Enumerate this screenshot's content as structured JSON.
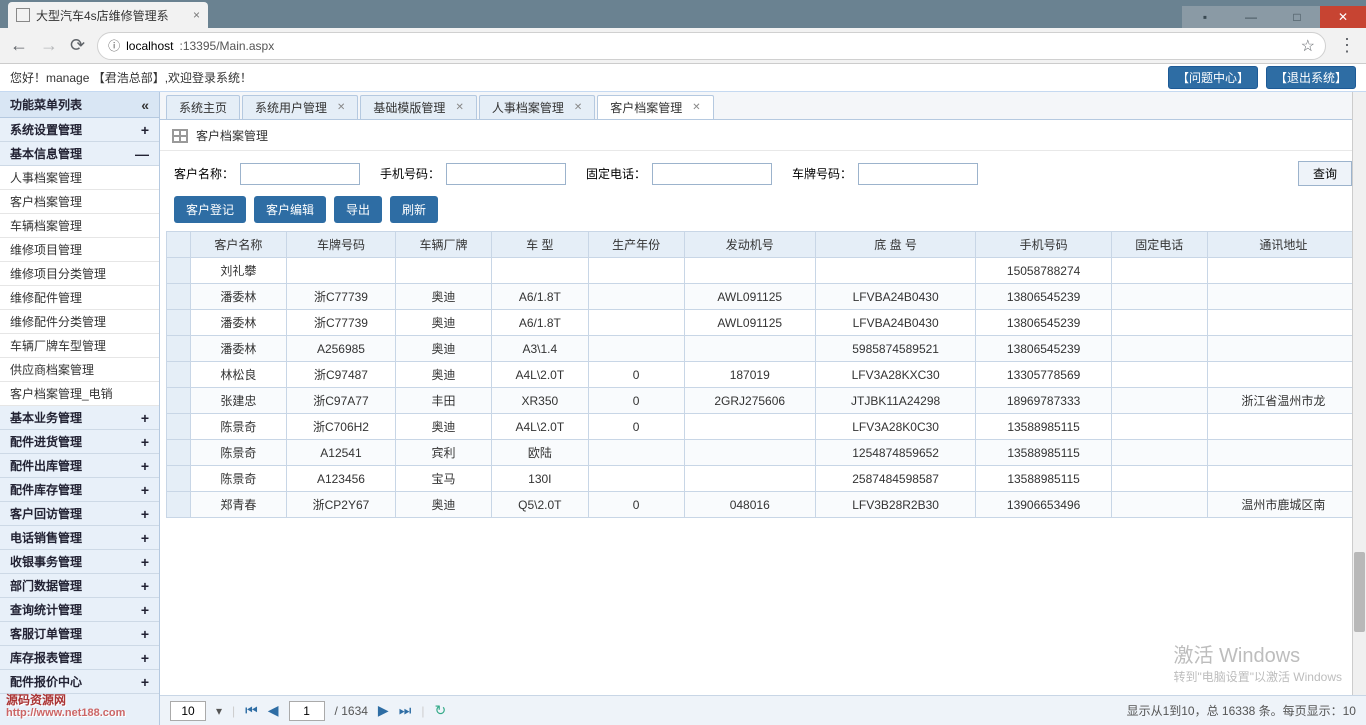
{
  "browser": {
    "tab_title": "大型汽车4s店维修管理系",
    "url_prefix": "localhost",
    "url_rest": ":13395/Main.aspx"
  },
  "header": {
    "greeting": "您好！manage 【君浩总部】,欢迎登录系统！",
    "btn_issue": "【问题中心】",
    "btn_logout": "【退出系统】"
  },
  "sidebar": {
    "title": "功能菜单列表",
    "groups": [
      {
        "label": "系统设置管理",
        "sign": "+"
      },
      {
        "label": "基本信息管理",
        "sign": "—",
        "items": [
          "人事档案管理",
          "客户档案管理",
          "车辆档案管理",
          "维修项目管理",
          "维修项目分类管理",
          "维修配件管理",
          "维修配件分类管理",
          "车辆厂牌车型管理",
          "供应商档案管理",
          "客户档案管理_电销"
        ]
      },
      {
        "label": "基本业务管理",
        "sign": "+"
      },
      {
        "label": "配件进货管理",
        "sign": "+"
      },
      {
        "label": "配件出库管理",
        "sign": "+"
      },
      {
        "label": "配件库存管理",
        "sign": "+"
      },
      {
        "label": "客户回访管理",
        "sign": "+"
      },
      {
        "label": "电话销售管理",
        "sign": "+"
      },
      {
        "label": "收银事务管理",
        "sign": "+"
      },
      {
        "label": "部门数据管理",
        "sign": "+"
      },
      {
        "label": "查询统计管理",
        "sign": "+"
      },
      {
        "label": "客服订单管理",
        "sign": "+"
      },
      {
        "label": "库存报表管理",
        "sign": "+"
      },
      {
        "label": "配件报价中心",
        "sign": "+"
      }
    ]
  },
  "tabs": [
    {
      "label": "系统主页",
      "closable": false
    },
    {
      "label": "系统用户管理",
      "closable": true
    },
    {
      "label": "基础模版管理",
      "closable": true
    },
    {
      "label": "人事档案管理",
      "closable": true
    },
    {
      "label": "客户档案管理",
      "closable": true,
      "active": true
    }
  ],
  "crumb": "客户档案管理",
  "search": {
    "f1": "客户名称：",
    "f2": "手机号码：",
    "f3": "固定电话：",
    "f4": "车牌号码：",
    "query": "查询"
  },
  "toolbar": [
    "客户登记",
    "客户编辑",
    "导出",
    "刷新"
  ],
  "columns": [
    "客户名称",
    "车牌号码",
    "车辆厂牌",
    "车 型",
    "生产年份",
    "发动机号",
    "底 盘 号",
    "手机号码",
    "固定电话",
    "通讯地址"
  ],
  "rows": [
    [
      "刘礼攀",
      "",
      "",
      "",
      "",
      "",
      "",
      "15058788274",
      "",
      ""
    ],
    [
      "潘委林",
      "浙C77739",
      "奥迪",
      "A6/1.8T",
      "",
      "AWL091125",
      "LFVBA24B0430",
      "13806545239",
      "",
      ""
    ],
    [
      "潘委林",
      "浙C77739",
      "奥迪",
      "A6/1.8T",
      "",
      "AWL091125",
      "LFVBA24B0430",
      "13806545239",
      "",
      ""
    ],
    [
      "潘委林",
      "A256985",
      "奥迪",
      "A3\\1.4",
      "",
      "",
      "5985874589521",
      "13806545239",
      "",
      ""
    ],
    [
      "林松良",
      "浙C97487",
      "奥迪",
      "A4L\\2.0T",
      "0",
      "187019",
      "LFV3A28KXC30",
      "13305778569",
      "",
      ""
    ],
    [
      "张建忠",
      "浙C97A77",
      "丰田",
      "XR350",
      "0",
      "2GRJ275606",
      "JTJBK11A24298",
      "18969787333",
      "",
      "浙江省温州市龙"
    ],
    [
      "陈景奇",
      "浙C706H2",
      "奥迪",
      "A4L\\2.0T",
      "0",
      "",
      "LFV3A28K0C30",
      "13588985115",
      "",
      ""
    ],
    [
      "陈景奇",
      "A12541",
      "宾利",
      "欧陆",
      "",
      "",
      "1254874859652",
      "13588985115",
      "",
      ""
    ],
    [
      "陈景奇",
      "A123456",
      "宝马",
      "130I",
      "",
      "",
      "2587484598587",
      "13588985115",
      "",
      ""
    ],
    [
      "郑青春",
      "浙CP2Y67",
      "奥迪",
      "Q5\\2.0T",
      "0",
      "048016",
      "LFV3B28R2B30",
      "13906653496",
      "",
      "温州市鹿城区南"
    ]
  ],
  "pager": {
    "size": "10",
    "page": "1",
    "total_pages": "/ 1634",
    "status": "显示从1到10，总 16338 条。每页显示：10"
  },
  "watermark": {
    "l1": "激活 Windows",
    "l2": "转到\"电脑设置\"以激活 Windows"
  },
  "logo": {
    "t": "源码资源网",
    "u": "http://www.net188.com"
  }
}
